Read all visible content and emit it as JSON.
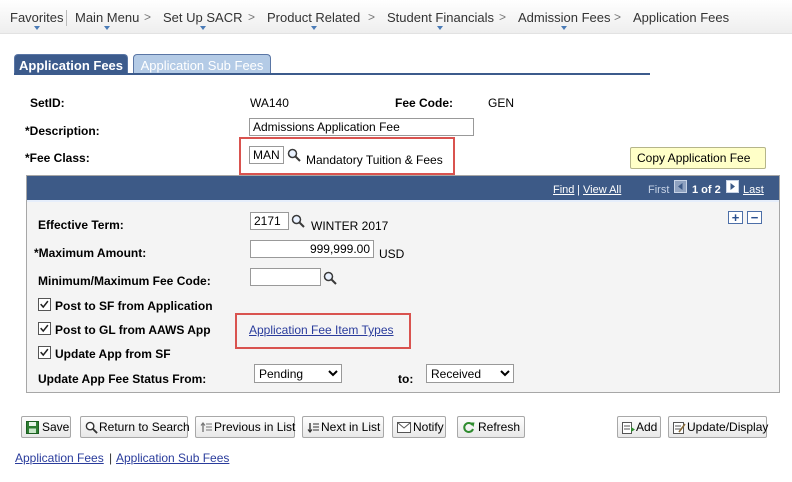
{
  "breadcrumb": {
    "items": [
      "Favorites",
      "Main Menu",
      "Set Up SACR",
      "Product Related",
      "Student Financials",
      "Admission Fees",
      "Application Fees"
    ],
    "separator": ">"
  },
  "tabs": [
    {
      "label": "Application Fees",
      "active": true
    },
    {
      "label": "Application Sub Fees",
      "active": false
    }
  ],
  "form": {
    "setid_label": "SetID:",
    "setid_value": "WA140",
    "fee_code_label": "Fee Code:",
    "fee_code_value": "GEN",
    "description_label": "*Description:",
    "description_value": "Admissions Application Fee",
    "fee_class_label": "*Fee Class:",
    "fee_class_value": "MAN",
    "fee_class_desc": "Mandatory Tuition & Fees",
    "copy_button": "Copy Application Fee"
  },
  "group": {
    "find": "Find",
    "view_all": "View All",
    "first": "First",
    "pager": "1 of 2",
    "last": "Last",
    "effective_term_label": "Effective Term:",
    "effective_term_value": "2171",
    "effective_term_desc": "WINTER 2017",
    "max_amount_label": "*Maximum Amount:",
    "max_amount_value": "999,999.00",
    "currency": "USD",
    "min_max_label": "Minimum/Maximum Fee Code:",
    "min_max_value": "",
    "post_sf_label": "Post to SF from Application",
    "post_sf_checked": true,
    "post_gl_label": "Post to GL from AAWS App",
    "post_gl_checked": true,
    "update_app_label": "Update App from SF",
    "update_app_checked": true,
    "item_types_link": "Application Fee Item Types",
    "status_from_label": "Update App Fee Status From:",
    "status_from_value": "Pending",
    "to_label": "to:",
    "status_to_value": "Received"
  },
  "toolbar": {
    "save": "Save",
    "return_search": "Return to Search",
    "prev": "Previous in List",
    "next": "Next in List",
    "notify": "Notify",
    "refresh": "Refresh",
    "add": "Add",
    "update_display": "Update/Display"
  },
  "footer_links": {
    "app_fees": "Application Fees",
    "separator": "|",
    "app_sub_fees": "Application Sub Fees"
  },
  "colors": {
    "group_header": "#3d5a87",
    "tab_active": "#3c5b8c",
    "highlight_box": "#d9534f",
    "link": "#2a3c9c"
  }
}
